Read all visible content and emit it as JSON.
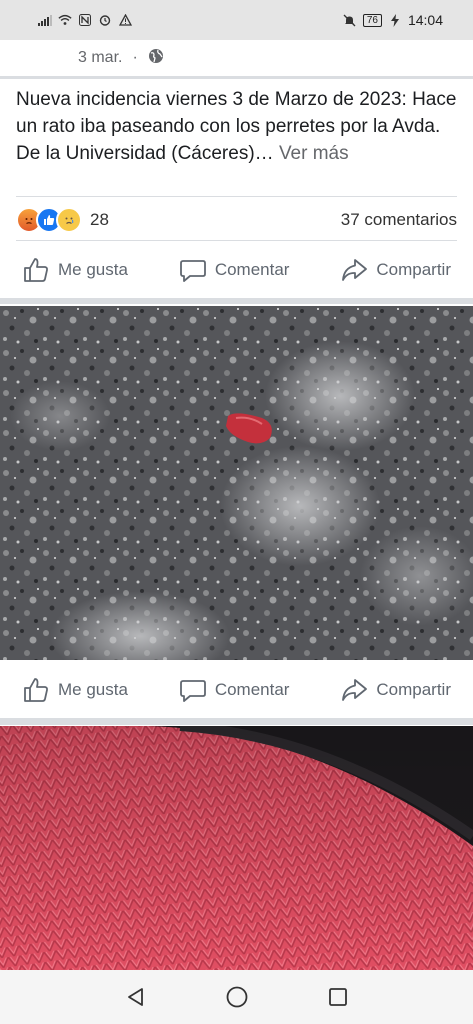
{
  "status_bar": {
    "time": "14:04",
    "battery": "76"
  },
  "post": {
    "date": "3 mar.",
    "date_separator": "·",
    "text": "Nueva incidencia viernes 3 de Marzo de 2023: Hace un rato iba paseando con los perretes por la Avda. De la Universidad (Cáceres)…",
    "see_more": "Ver más",
    "reaction_count": "28",
    "comments": "37 comentarios",
    "actions": {
      "like": "Me gusta",
      "comment": "Comentar",
      "share": "Compartir"
    }
  },
  "photo_actions": {
    "like": "Me gusta",
    "comment": "Comentar",
    "share": "Compartir"
  },
  "icons": {
    "reaction_1": "angry-reaction-icon",
    "reaction_2": "like-reaction-icon",
    "reaction_3": "sad-reaction-icon",
    "privacy": "globe-icon"
  },
  "colors": {
    "brand_blue": "#1877f2",
    "action_gray": "#606770",
    "divider": "#dadde1"
  }
}
